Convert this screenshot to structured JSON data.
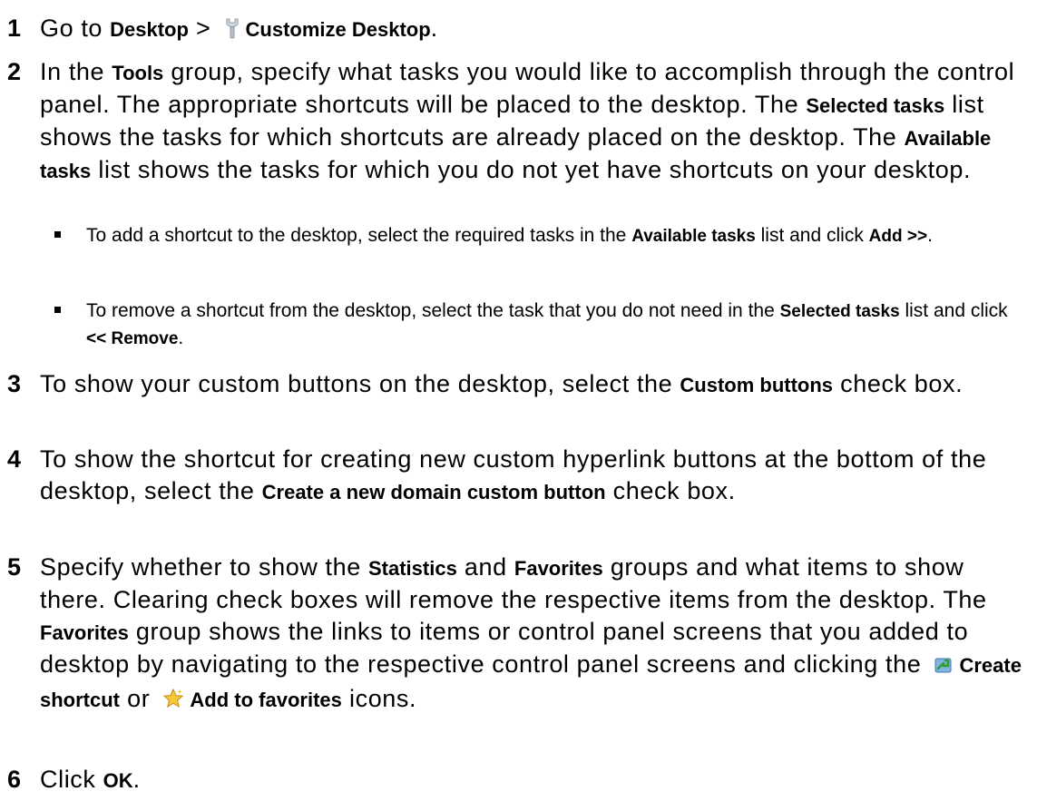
{
  "steps": [
    {
      "num": "1",
      "parts": {
        "a": "Go to ",
        "b1": "Desktop",
        "c": " > ",
        "b2": "Customize Desktop",
        "d": "."
      },
      "icons": {
        "customize": "wrench-icon"
      }
    },
    {
      "num": "2",
      "parts": {
        "a": "In the ",
        "b1": "Tools",
        "c": " group, specify what tasks you would like to accomplish through the control panel. The appropriate shortcuts will be placed to the desktop. The ",
        "b2": "Selected tasks",
        "d": " list shows the tasks for which shortcuts are already placed on the desktop. The ",
        "b3": "Available tasks",
        "e": " list shows the tasks for which you do not yet have shortcuts on your desktop."
      },
      "bullets": [
        {
          "a": "To add a shortcut to the desktop, select the required tasks in the ",
          "b1": "Available tasks",
          "c": " list and click ",
          "b2": "Add >>",
          "d": "."
        },
        {
          "a": "To remove a shortcut from the desktop, select the task that you do not need in the ",
          "b1": "Selected tasks",
          "c": " list and click ",
          "b2": "<< Remove",
          "d": "."
        }
      ]
    },
    {
      "num": "3",
      "parts": {
        "a": "To show your custom buttons on the desktop, select the ",
        "b1": "Custom buttons",
        "c": " check box."
      }
    },
    {
      "num": "4",
      "parts": {
        "a": "To show the shortcut for creating new custom hyperlink buttons at the bottom of the desktop, select the ",
        "b1": "Create a new domain custom button",
        "c": " check box."
      }
    },
    {
      "num": "5",
      "parts": {
        "a": "Specify whether to show the ",
        "b1": "Statistics",
        "c": " and ",
        "b2": "Favorites",
        "d": " groups and what items to show there. Clearing check boxes will remove the respective items from the desktop. The ",
        "b3": "Favorites",
        "e": " group shows the links to items or control panel screens that you added to desktop by navigating to the respective control panel screens and clicking the ",
        "b4": "Create shortcut",
        "f": " or ",
        "b5": "Add to favorites",
        "g": " icons."
      },
      "icons": {
        "shortcut": "create-shortcut-icon",
        "favorites": "star-icon"
      }
    },
    {
      "num": "6",
      "parts": {
        "a": "Click ",
        "b1": "OK",
        "c": "."
      }
    }
  ]
}
